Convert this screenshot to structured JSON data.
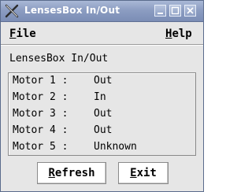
{
  "window": {
    "title": "LensesBox In/Out",
    "controls": [
      "minimize",
      "maximize",
      "close"
    ]
  },
  "menubar": {
    "file": {
      "mnemonic": "F",
      "rest": "ile"
    },
    "help": {
      "mnemonic": "H",
      "rest": "elp"
    }
  },
  "heading": "LensesBox In/Out",
  "motors": [
    {
      "label": "Motor 1 :",
      "status": "Out"
    },
    {
      "label": "Motor 2 :",
      "status": "In"
    },
    {
      "label": "Motor 3 :",
      "status": "Out"
    },
    {
      "label": "Motor 4 :",
      "status": "Out"
    },
    {
      "label": "Motor 5 :",
      "status": "Unknown"
    }
  ],
  "buttons": {
    "refresh": {
      "mnemonic": "R",
      "rest": "efresh"
    },
    "exit": {
      "mnemonic": "E",
      "rest": "xit"
    }
  },
  "colors": {
    "titlebar": "#8c9dc2",
    "title_text": "#ffffff",
    "window_bg": "#e6e6e6",
    "button_bg": "#ffffff"
  },
  "icons": {
    "app": "x-logo-icon",
    "minimize": "minimize-icon",
    "maximize": "maximize-icon",
    "close": "close-icon"
  }
}
